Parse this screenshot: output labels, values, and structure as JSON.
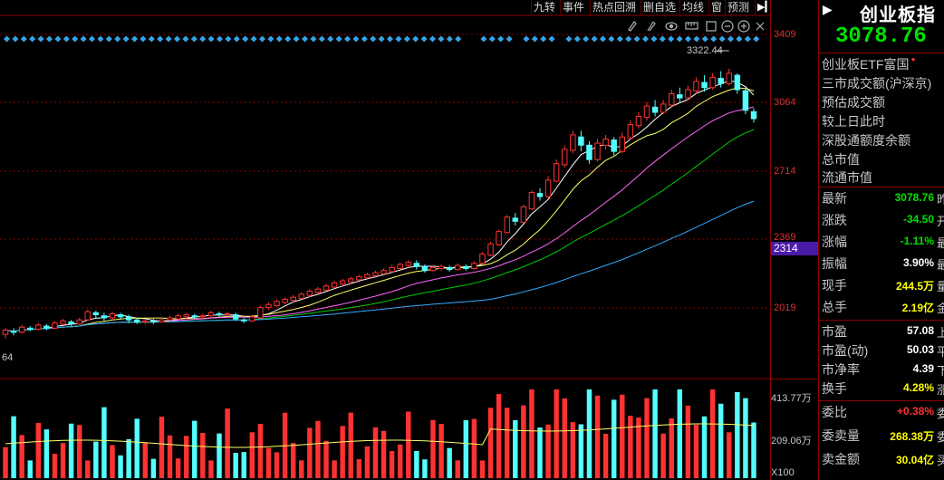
{
  "toolbar": {
    "tabs": [
      "九转",
      "事件",
      "热点回溯",
      "删自选",
      "均线",
      "窗",
      "预测"
    ],
    "expand_icon": "play-icon"
  },
  "chart_tools": {
    "icons": [
      "pencil-icon",
      "pen-icon",
      "eye-icon",
      "ruler-icon",
      "square-icon",
      "zoom-out-icon",
      "zoom-in-icon",
      "close-icon"
    ]
  },
  "axis": {
    "price_labels": [
      "3409",
      "3064",
      "2714",
      "2369",
      "2019"
    ],
    "current_price_tag": "2314",
    "left_label": "64",
    "volume_labels": [
      "413.77万",
      "209.06万"
    ],
    "volume_unit": "X100"
  },
  "annotation": {
    "high": "3322.44"
  },
  "colors": {
    "up": "#ff3232",
    "down": "#54ffff",
    "ma5": "#ffffff",
    "ma10": "#ffff66",
    "ma20": "#ff66ff",
    "ma30": "#00cc00",
    "ma60": "#33aaff",
    "grid": "#8b0000"
  },
  "chart_data": {
    "type": "candlestick",
    "y_range": [
      1850,
      3480
    ],
    "candles": [
      [
        2030,
        2050,
        2010,
        2060
      ],
      [
        2045,
        2040,
        2025,
        2060
      ],
      [
        2040,
        2065,
        2035,
        2075
      ],
      [
        2060,
        2055,
        2045,
        2070
      ],
      [
        2055,
        2075,
        2050,
        2085
      ],
      [
        2070,
        2060,
        2050,
        2080
      ],
      [
        2060,
        2085,
        2055,
        2095
      ],
      [
        2080,
        2095,
        2075,
        2105
      ],
      [
        2090,
        2080,
        2070,
        2100
      ],
      [
        2080,
        2100,
        2075,
        2110
      ],
      [
        2100,
        2140,
        2095,
        2150
      ],
      [
        2135,
        2125,
        2110,
        2145
      ],
      [
        2120,
        2110,
        2095,
        2135
      ],
      [
        2110,
        2130,
        2100,
        2140
      ],
      [
        2125,
        2115,
        2100,
        2135
      ],
      [
        2115,
        2100,
        2085,
        2125
      ],
      [
        2100,
        2090,
        2080,
        2110
      ],
      [
        2090,
        2095,
        2080,
        2105
      ],
      [
        2095,
        2090,
        2080,
        2105
      ],
      [
        2090,
        2100,
        2085,
        2110
      ],
      [
        2100,
        2110,
        2095,
        2120
      ],
      [
        2105,
        2120,
        2100,
        2130
      ],
      [
        2115,
        2125,
        2105,
        2135
      ],
      [
        2120,
        2115,
        2105,
        2130
      ],
      [
        2115,
        2120,
        2105,
        2130
      ],
      [
        2120,
        2135,
        2110,
        2145
      ],
      [
        2130,
        2125,
        2115,
        2140
      ],
      [
        2125,
        2130,
        2115,
        2140
      ],
      [
        2125,
        2105,
        2095,
        2135
      ],
      [
        2100,
        2095,
        2085,
        2110
      ],
      [
        2095,
        2115,
        2090,
        2125
      ],
      [
        2110,
        2160,
        2105,
        2170
      ],
      [
        2160,
        2175,
        2150,
        2185
      ],
      [
        2170,
        2190,
        2165,
        2200
      ],
      [
        2185,
        2200,
        2175,
        2210
      ],
      [
        2195,
        2210,
        2185,
        2220
      ],
      [
        2205,
        2225,
        2200,
        2235
      ],
      [
        2220,
        2240,
        2210,
        2250
      ],
      [
        2235,
        2250,
        2225,
        2260
      ],
      [
        2245,
        2265,
        2240,
        2275
      ],
      [
        2260,
        2280,
        2255,
        2290
      ],
      [
        2275,
        2290,
        2265,
        2300
      ],
      [
        2285,
        2300,
        2275,
        2310
      ],
      [
        2295,
        2310,
        2290,
        2320
      ],
      [
        2305,
        2320,
        2295,
        2330
      ],
      [
        2315,
        2330,
        2310,
        2340
      ],
      [
        2325,
        2340,
        2315,
        2350
      ],
      [
        2335,
        2355,
        2330,
        2365
      ],
      [
        2350,
        2370,
        2345,
        2380
      ],
      [
        2365,
        2380,
        2355,
        2390
      ],
      [
        2375,
        2360,
        2345,
        2390
      ],
      [
        2360,
        2340,
        2330,
        2370
      ],
      [
        2340,
        2355,
        2335,
        2365
      ],
      [
        2350,
        2360,
        2340,
        2370
      ],
      [
        2355,
        2345,
        2335,
        2365
      ],
      [
        2345,
        2365,
        2340,
        2375
      ],
      [
        2360,
        2350,
        2340,
        2370
      ],
      [
        2350,
        2375,
        2345,
        2385
      ],
      [
        2375,
        2420,
        2370,
        2430
      ],
      [
        2415,
        2470,
        2410,
        2480
      ],
      [
        2465,
        2530,
        2460,
        2540
      ],
      [
        2525,
        2600,
        2520,
        2610
      ],
      [
        2595,
        2580,
        2560,
        2620
      ],
      [
        2575,
        2650,
        2570,
        2660
      ],
      [
        2640,
        2720,
        2635,
        2730
      ],
      [
        2715,
        2700,
        2680,
        2740
      ],
      [
        2700,
        2780,
        2690,
        2800
      ],
      [
        2775,
        2860,
        2770,
        2880
      ],
      [
        2855,
        2930,
        2840,
        2950
      ],
      [
        2925,
        3000,
        2910,
        3020
      ],
      [
        2990,
        2950,
        2920,
        3020
      ],
      [
        2950,
        2880,
        2860,
        2970
      ],
      [
        2880,
        2960,
        2870,
        2980
      ],
      [
        2950,
        2980,
        2930,
        3000
      ],
      [
        2975,
        2920,
        2900,
        2990
      ],
      [
        2920,
        2990,
        2910,
        3010
      ],
      [
        2985,
        3050,
        2975,
        3070
      ],
      [
        3045,
        3090,
        3030,
        3110
      ],
      [
        3085,
        3140,
        3070,
        3160
      ],
      [
        3135,
        3110,
        3090,
        3170
      ],
      [
        3110,
        3150,
        3100,
        3170
      ],
      [
        3145,
        3200,
        3130,
        3220
      ],
      [
        3195,
        3180,
        3160,
        3230
      ],
      [
        3180,
        3220,
        3170,
        3240
      ],
      [
        3215,
        3260,
        3200,
        3280
      ],
      [
        3255,
        3230,
        3210,
        3290
      ],
      [
        3230,
        3280,
        3220,
        3300
      ],
      [
        3275,
        3250,
        3230,
        3310
      ],
      [
        3250,
        3300,
        3240,
        3322.44
      ],
      [
        3290,
        3220,
        3200,
        3300
      ],
      [
        3215,
        3120,
        3100,
        3230
      ],
      [
        3113,
        3079,
        3060,
        3130
      ]
    ]
  },
  "right_panel": {
    "title": "创业板指",
    "price": "3078.76",
    "etf": "创业板ETF富国",
    "info_items": [
      "三市成交额(沪深京)",
      "预估成交额",
      "较上日此时",
      "深股通额度余额",
      "总市值",
      "流通市值"
    ],
    "quotes": [
      {
        "label": "最新",
        "value": "3078.76",
        "suffix": "昨",
        "color": "#00e000"
      },
      {
        "label": "涨跌",
        "value": "-34.50",
        "suffix": "开",
        "color": "#00e000"
      },
      {
        "label": "涨幅",
        "value": "-1.11%",
        "suffix": "最",
        "color": "#00e000"
      },
      {
        "label": "振幅",
        "value": "3.90%",
        "suffix": "最",
        "color": "#ffffff"
      },
      {
        "label": "现手",
        "value": "244.5万",
        "suffix": "量",
        "color": "#ffff00"
      },
      {
        "label": "总手",
        "value": "2.19亿",
        "suffix": "金",
        "color": "#ffff00"
      }
    ],
    "ratios": [
      {
        "label": "市盈",
        "value": "57.08",
        "suffix": "上"
      },
      {
        "label": "市盈(动)",
        "value": "50.03",
        "suffix": "平"
      },
      {
        "label": "市净率",
        "value": "4.39",
        "suffix": "下"
      },
      {
        "label": "换手",
        "value": "4.28%",
        "suffix": "涨",
        "color": "#ffff00"
      }
    ],
    "orders": [
      {
        "label": "委比",
        "value": "+0.38%",
        "suffix": "委",
        "color": "#ff3232"
      },
      {
        "label": "委卖量",
        "value": "268.38万",
        "suffix": "委",
        "color": "#ffff00"
      },
      {
        "label": "卖金额",
        "value": "30.04亿",
        "suffix": "买",
        "color": "#ffff00"
      }
    ]
  }
}
